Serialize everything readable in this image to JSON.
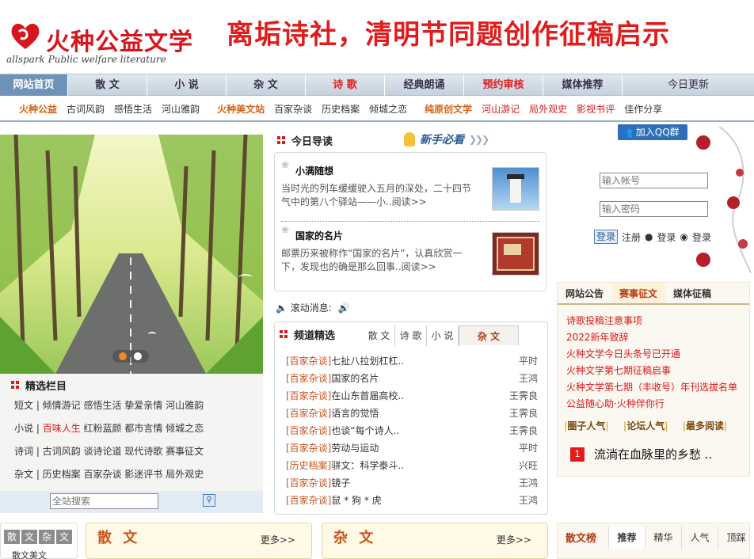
{
  "header": {
    "logo_text": "火种公益文学",
    "logo_en": "allspark Public welfare literature",
    "banner": "离垢诗社，清明节同题创作征稿启示"
  },
  "mainnav": [
    {
      "label": "网站首页",
      "style": "active"
    },
    {
      "label": "散 文",
      "style": ""
    },
    {
      "label": "小 说",
      "style": ""
    },
    {
      "label": "杂 文",
      "style": ""
    },
    {
      "label": "诗 歌",
      "style": "red"
    },
    {
      "label": "经典朗诵",
      "style": ""
    },
    {
      "label": "预约审核",
      "style": "red"
    },
    {
      "label": "媒体推荐",
      "style": ""
    },
    {
      "label": "今日更新",
      "style": "plain"
    }
  ],
  "subnav": [
    {
      "label": "火种公益",
      "style": "bold"
    },
    {
      "label": "古词风韵",
      "style": ""
    },
    {
      "label": "感悟生活",
      "style": ""
    },
    {
      "label": "河山雅韵",
      "style": ""
    },
    {
      "label": "火种美文站",
      "style": "bold"
    },
    {
      "label": "百家杂谈",
      "style": ""
    },
    {
      "label": "历史档案",
      "style": ""
    },
    {
      "label": "倾城之恋",
      "style": ""
    },
    {
      "label": "纯原创文学",
      "style": "bold"
    },
    {
      "label": "河山游记",
      "style": "red"
    },
    {
      "label": "局外观史",
      "style": "red"
    },
    {
      "label": "影视书评",
      "style": "red"
    },
    {
      "label": "佳作分享",
      "style": ""
    }
  ],
  "columns": {
    "title": "精选栏目",
    "rows": [
      "短文 | 倾情游记 感悟生活 挚爱亲情 河山雅韵",
      [
        "小说 | ",
        "百味人生",
        " 红粉蓝颜 都市言情 倾城之恋"
      ],
      "诗词 | 古词风韵 谈诗论道 现代诗歌 赛事征文",
      "杂文 | 历史档案 百家杂谈 影迷评书 局外观史"
    ],
    "search_placeholder": "全站搜索"
  },
  "guide": {
    "title": "今日导读",
    "newbie": "新手必看",
    "items": [
      {
        "title": "小满随想",
        "desc": "当时光的列车缓缓驶入五月的深处，二十四节气中的第八个驿站——小..阅读>>"
      },
      {
        "title": "国家的名片",
        "desc": "邮票历来被称作“国家的名片”，认真欣赏一下，发现也的确是那么回事..阅读>>"
      }
    ],
    "scroll_label": "滚动消息:"
  },
  "channel": {
    "title": "频道精选",
    "tabs": [
      "散 文",
      "诗 歌",
      "小 说",
      "杂 文"
    ],
    "rows": [
      {
        "tag": "[百家杂谈]",
        "title": "七扯八拉划杠杠..",
        "author": "平时"
      },
      {
        "tag": "[百家杂谈]",
        "title": "国家的名片",
        "author": "王鸿"
      },
      {
        "tag": "[百家杂谈]",
        "title": "在山东首届高校..",
        "author": "王霁良"
      },
      {
        "tag": "[百家杂谈]",
        "title": "语言的觉悟",
        "author": "王霁良"
      },
      {
        "tag": "[百家杂谈]",
        "title": "也谈“每个诗人..",
        "author": "王霁良"
      },
      {
        "tag": "[百家杂谈]",
        "title": "劳动与运动",
        "author": "平时"
      },
      {
        "tag": "[历史档案]",
        "title": "骈文：科学泰斗..",
        "author": "兴旺"
      },
      {
        "tag": "[百家杂谈]",
        "title": "镜子",
        "author": "王鸿"
      },
      {
        "tag": "[百家杂谈]",
        "title": "鼠 * 狗 * 虎",
        "author": "王鸿"
      }
    ]
  },
  "login": {
    "qq_group": "加入QQ群",
    "account_placeholder": "输入帐号",
    "password_placeholder": "输入密码",
    "login_btn": "登录",
    "register": "注册",
    "qq_login": "登录",
    "wechat_login": "登录"
  },
  "notices": {
    "tabs": [
      "网站公告",
      "赛事征文",
      "媒体征稿"
    ],
    "items": [
      "诗歌投稿注意事项",
      "2022新年致辞",
      "火种文学今日头条号已开通",
      "火种文学第七期征稿启事",
      "火种文学第七期（丰收号）年刊选拔名单",
      "公益随心助·火种伴你行"
    ],
    "pop_tabs": [
      "圈子人气",
      "论坛人气",
      "最多阅读"
    ],
    "top_item": {
      "num": "1",
      "title": "流淌在血脉里的乡愁 .."
    }
  },
  "bottom": {
    "cat_tag": [
      "散",
      "文",
      "杂",
      "文"
    ],
    "cat_sub": "散文美文",
    "panel1_title": "散 文",
    "panel2_title": "杂 文",
    "more": "更多>>",
    "rank_title": "散文榜",
    "rank_tabs": [
      "推荐",
      "精华",
      "人气",
      "顶踩"
    ]
  },
  "colors": {
    "brand_red": "#e01d1d",
    "nav_active": "#6f93b8",
    "tag_orange": "#c8541e"
  }
}
